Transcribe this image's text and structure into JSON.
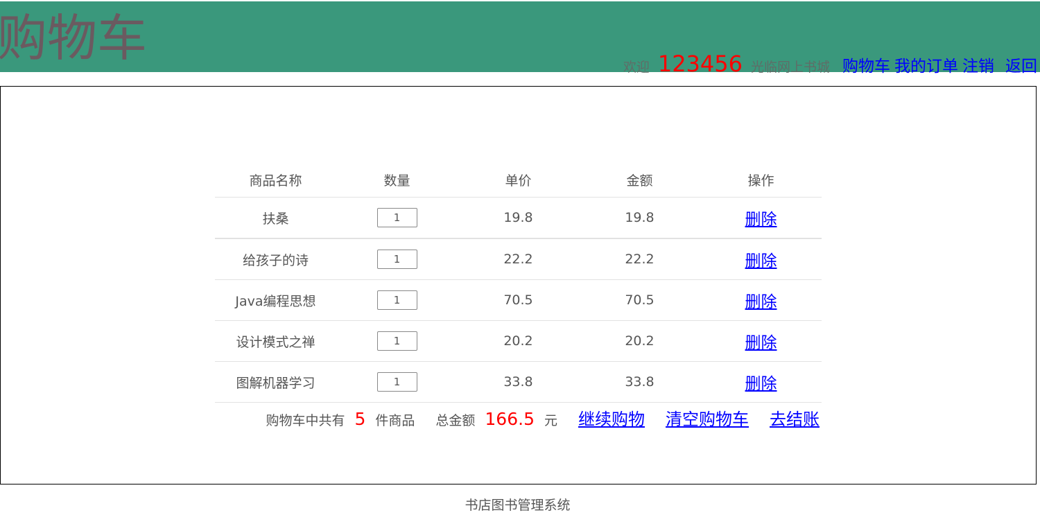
{
  "header": {
    "title": "购物车",
    "welcome_prefix": "欢迎",
    "username": "123456",
    "welcome_suffix": "光临网上书城",
    "nav_links": [
      "购物车",
      "我的订单",
      "注销",
      "返回"
    ]
  },
  "cart": {
    "columns": [
      "商品名称",
      "数量",
      "单价",
      "金额",
      "操作"
    ],
    "items": [
      {
        "name": "扶桑",
        "quantity": "1",
        "price": "19.8",
        "amount": "19.8",
        "action": "删除"
      },
      {
        "name": "给孩子的诗",
        "quantity": "1",
        "price": "22.2",
        "amount": "22.2",
        "action": "删除"
      },
      {
        "name": "Java编程思想",
        "quantity": "1",
        "price": "70.5",
        "amount": "70.5",
        "action": "删除"
      },
      {
        "name": "设计模式之禅",
        "quantity": "1",
        "price": "20.2",
        "amount": "20.2",
        "action": "删除"
      },
      {
        "name": "图解机器学习",
        "quantity": "1",
        "price": "33.8",
        "amount": "33.8",
        "action": "删除"
      }
    ]
  },
  "summary": {
    "count_prefix": "购物车中共有",
    "count": "5",
    "count_suffix": "件商品",
    "total_prefix": "总金额",
    "total": "166.5",
    "total_suffix": "元",
    "continue_label": "继续购物",
    "clear_label": "清空购物车",
    "checkout_label": "去结账"
  },
  "footer": {
    "text": "书店图书管理系统"
  },
  "colors": {
    "header_bg": "#3a987c",
    "link": "#0000ff",
    "highlight": "#ff0000"
  }
}
